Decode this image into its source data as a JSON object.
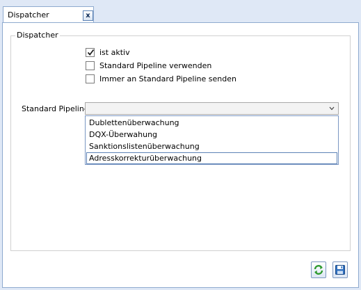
{
  "tab": {
    "title": "Dispatcher",
    "close_label": "x"
  },
  "group": {
    "legend": "Dispatcher"
  },
  "checkboxes": [
    {
      "label": "ist aktiv",
      "checked": true
    },
    {
      "label": "Standard Pipeline verwenden",
      "checked": false
    },
    {
      "label": "Immer an Standard Pipeline senden",
      "checked": false
    }
  ],
  "pipeline": {
    "label": "Standard Pipeline",
    "value": "",
    "options": [
      "Dublettenüberwachung",
      "DQX-Überwahung",
      "Sanktionslistenüberwachung",
      "Adresskorrekturüberwachung"
    ],
    "hovered_option": "Adresskorrekturüberwachung"
  },
  "buttons": {
    "refresh_icon": "refresh-icon",
    "save_icon": "save-icon"
  },
  "colors": {
    "background": "#dfe8f6",
    "border": "#8eaace",
    "highlight_border": "#5d83b6",
    "refresh_green": "#2e9a2e",
    "save_blue": "#2f6fbf"
  }
}
